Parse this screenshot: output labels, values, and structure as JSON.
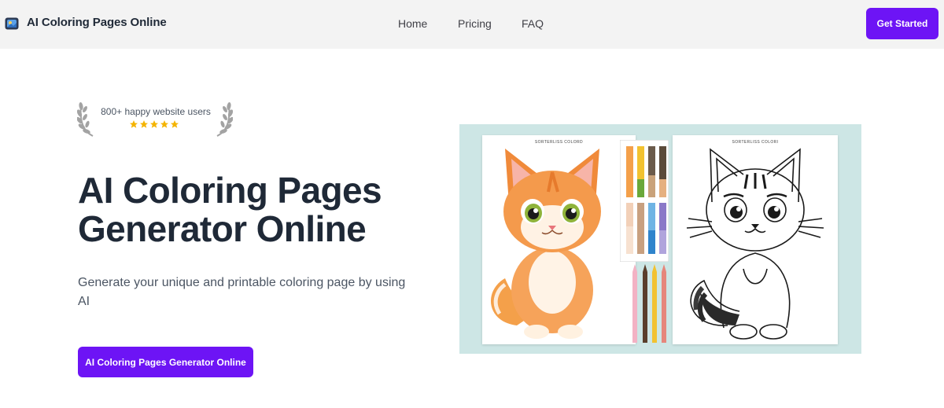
{
  "header": {
    "brand": "AI Coloring Pages Online",
    "logo_icon": "app-logo-icon",
    "nav": [
      {
        "label": "Home"
      },
      {
        "label": "Pricing"
      },
      {
        "label": "FAQ"
      }
    ],
    "cta_label": "Get Started"
  },
  "badge": {
    "text": "800+ happy website users",
    "rating": 5,
    "icons": [
      "laurel-left-icon",
      "laurel-right-icon",
      "star-icon"
    ]
  },
  "hero": {
    "title_line1": "AI Coloring Pages",
    "title_line2": "Generator Online",
    "subtitle": "Generate your unique and printable coloring page by using AI",
    "cta_label": "AI Coloring Pages Generator Online"
  },
  "illustration": {
    "color_page_label": "SORTERLISS COLORD",
    "bw_page_label": "SORTERLISS COLORI"
  },
  "colors": {
    "accent": "#6d14f5",
    "header_bg": "#f3f3f3",
    "text_dark": "#1f2937",
    "text_muted": "#4b5563",
    "star": "#f4b400",
    "art_bg": "#cde6e5"
  }
}
